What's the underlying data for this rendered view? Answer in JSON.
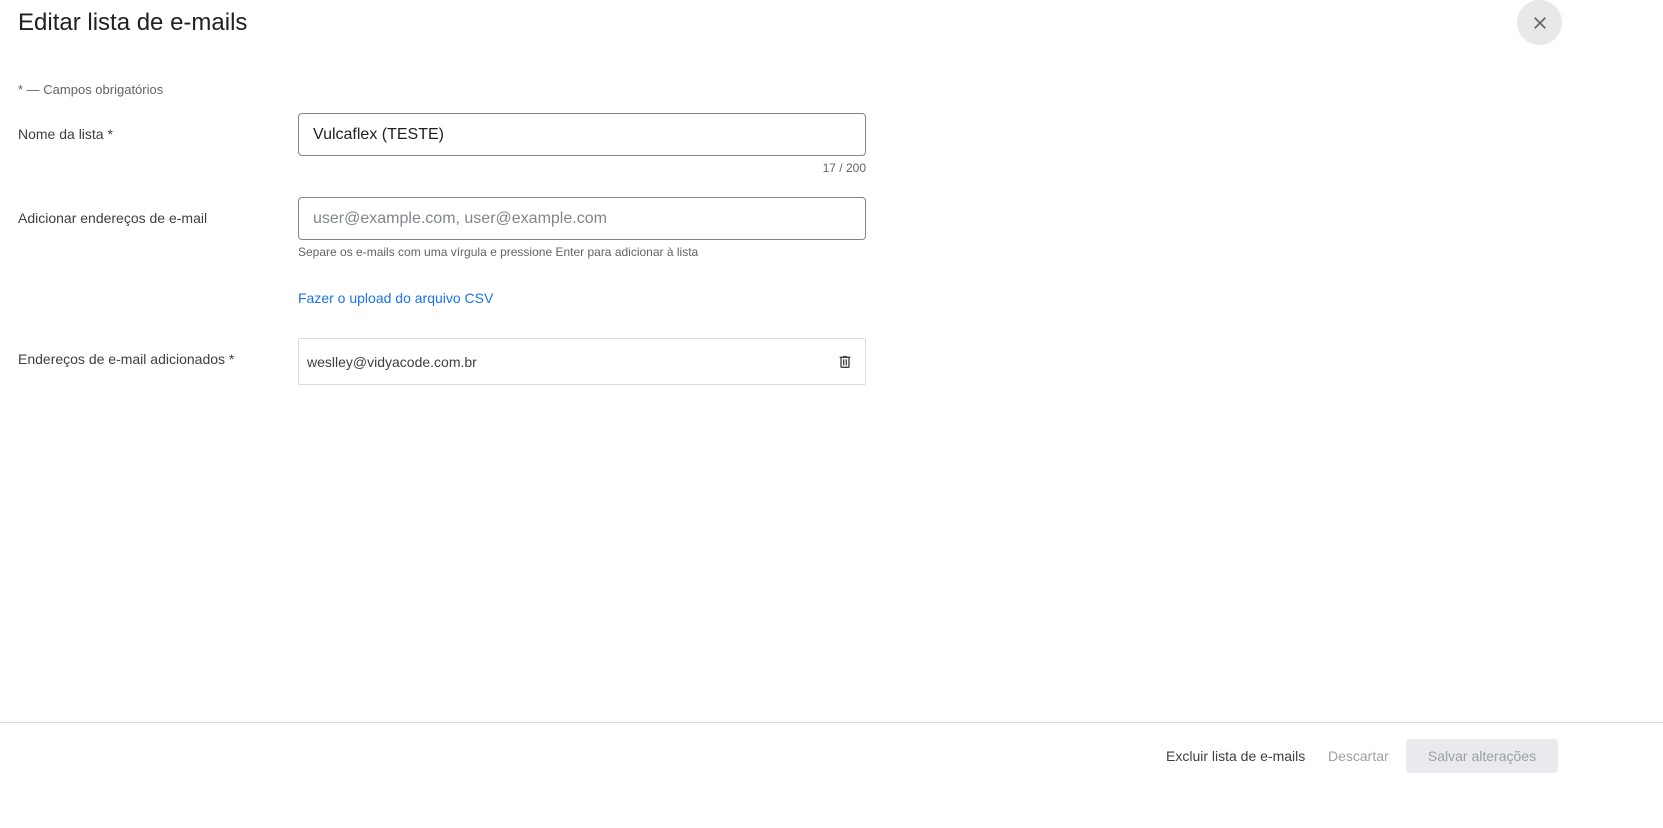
{
  "dialog": {
    "title": "Editar lista de e-mails",
    "close_icon": "close-icon"
  },
  "form": {
    "required_note": "* — Campos obrigatórios",
    "list_name": {
      "label": "Nome da lista  *",
      "value": "Vulcaflex (TESTE)",
      "counter": "17 / 200"
    },
    "add_emails": {
      "label": "Adicionar endereços de e-mail",
      "placeholder": "user@example.com, user@example.com",
      "helper": "Separe os e-mails com uma vírgula e pressione Enter para adicionar à lista"
    },
    "csv_link": "Fazer o upload do arquivo CSV",
    "added_emails": {
      "label": "Endereços de e-mail adicionados  *",
      "items": [
        "weslley@vidyacode.com.br"
      ],
      "delete_icon": "trash-icon"
    }
  },
  "footer": {
    "delete_label": "Excluir lista de e-mails",
    "discard_label": "Descartar",
    "save_label": "Salvar alterações"
  },
  "colors": {
    "link": "#1a73e8",
    "disabled_text": "#9aa0a6",
    "disabled_bg": "#e8eaed"
  }
}
